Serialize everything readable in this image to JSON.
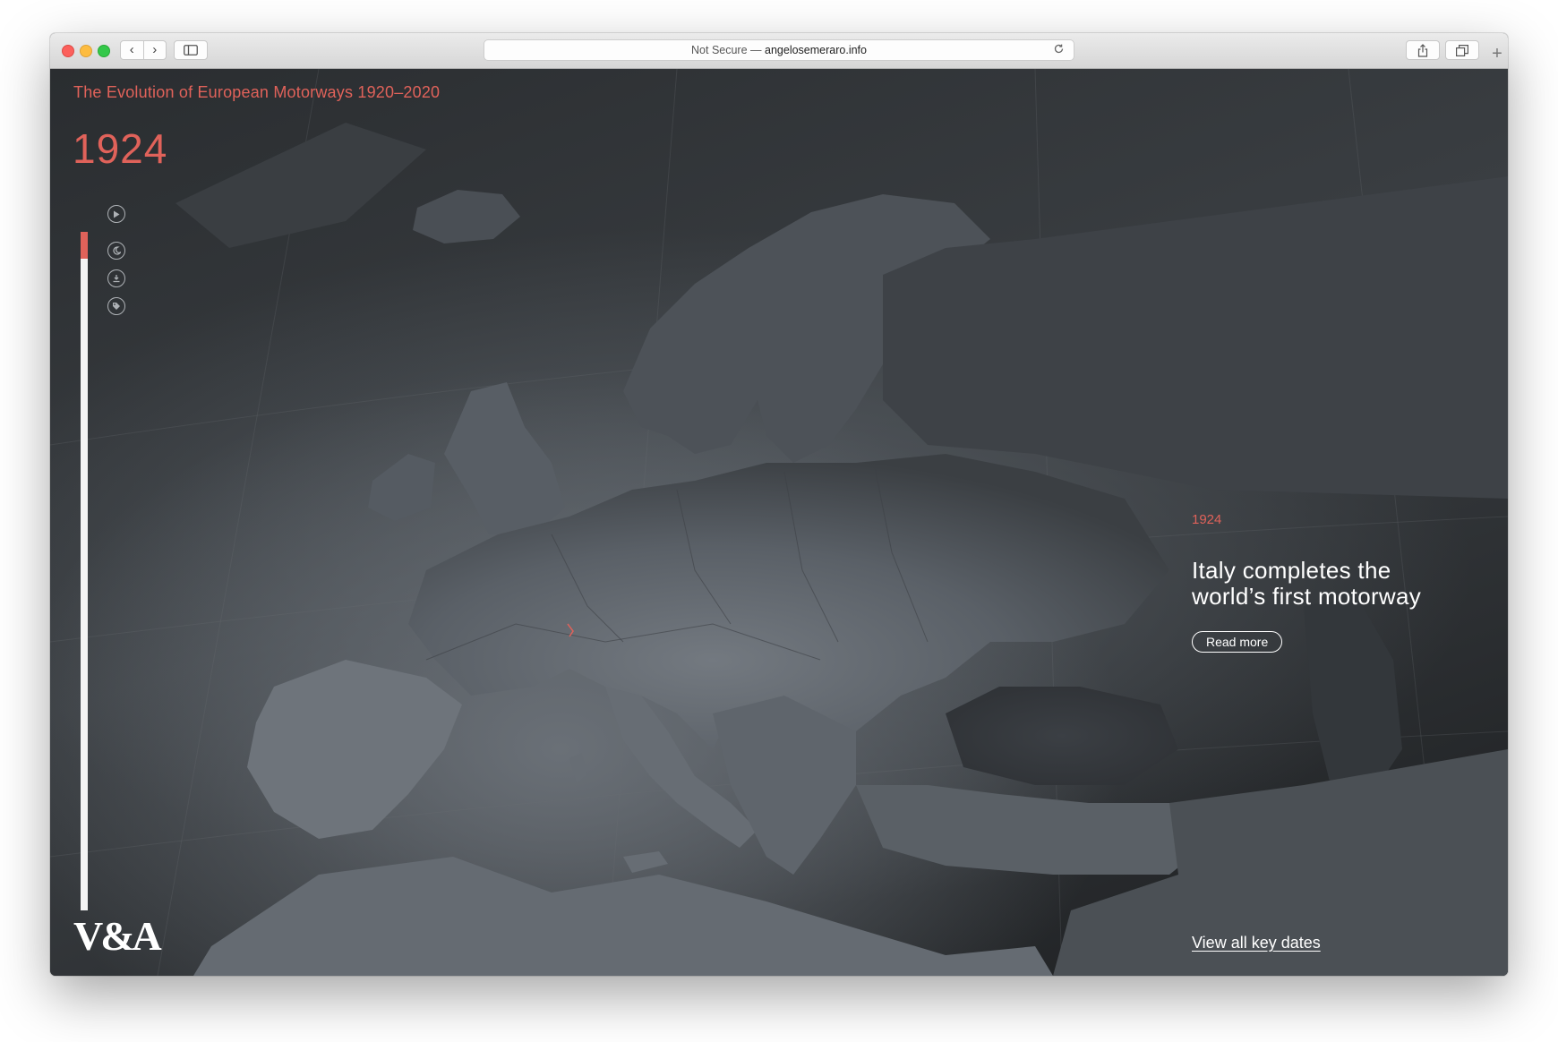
{
  "browser": {
    "address_prefix": "Not Secure —",
    "address_host": "angelosemeraro.info",
    "back_icon": "‹",
    "forward_icon": "›",
    "newtab_icon": "+"
  },
  "page": {
    "title": "The Evolution of European Motorways 1920–2020",
    "current_year": "1924",
    "timeline_progress": 0.04,
    "controls": [
      {
        "name": "play-icon"
      },
      {
        "name": "moon-icon"
      },
      {
        "name": "download-icon"
      },
      {
        "name": "tag-icon"
      }
    ],
    "event": {
      "year": "1924",
      "headline": "Italy completes the world’s first motorway",
      "read_more": "Read more"
    },
    "key_dates_link": "View all key dates",
    "logo": "V&A"
  },
  "colors": {
    "accent": "#e0625a",
    "background": "#2c3033",
    "land": "#5d636a"
  }
}
